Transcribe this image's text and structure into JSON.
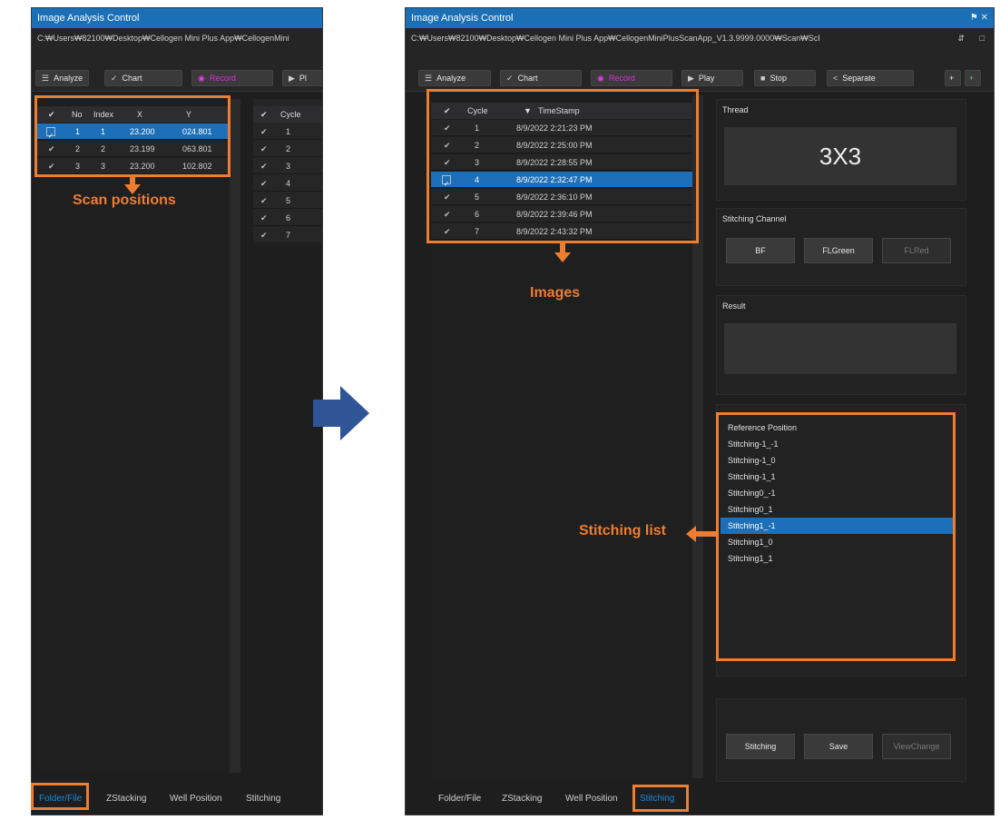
{
  "left_window": {
    "title": "Image Analysis Control",
    "path": "C:₩Users₩82100₩Desktop₩Cellogen Mini Plus App₩CellogenMini",
    "toolbar": {
      "analyze": "Analyze",
      "chart": "Chart",
      "record": "Record",
      "play": "Pl"
    },
    "scan_table": {
      "headers": [
        "✔",
        "No",
        "Index",
        "X",
        "Y"
      ],
      "rows": [
        {
          "no": "1",
          "index": "1",
          "x": "23.200",
          "y": "024.801"
        },
        {
          "no": "2",
          "index": "2",
          "x": "23.199",
          "y": "063.801"
        },
        {
          "no": "3",
          "index": "3",
          "x": "23.200",
          "y": "102.802"
        }
      ]
    },
    "cycle_table": {
      "headers": [
        "✔",
        "Cycle"
      ],
      "rows": [
        "1",
        "2",
        "3",
        "4",
        "5",
        "6",
        "7"
      ]
    },
    "tabs": [
      "Folder/File",
      "ZStacking",
      "Well Position",
      "Stitching"
    ]
  },
  "right_window": {
    "title": "Image Analysis Control",
    "path": "C:₩Users₩82100₩Desktop₩Cellogen Mini Plus App₩CellogenMiniPlusScanApp_V1.3.9999.0000₩Scan₩ScI",
    "toolbar": {
      "analyze": "Analyze",
      "chart": "Chart",
      "record": "Record",
      "play": "Play",
      "stop": "Stop",
      "separate": "Separate"
    },
    "images_table": {
      "headers": [
        "✔",
        "Cycle",
        "TimeStamp"
      ],
      "rows": [
        {
          "cycle": "1",
          "ts": "8/9/2022 2:21:23 PM"
        },
        {
          "cycle": "2",
          "ts": "8/9/2022 2:25:00 PM"
        },
        {
          "cycle": "3",
          "ts": "8/9/2022 2:28:55 PM"
        },
        {
          "cycle": "4",
          "ts": "8/9/2022 2:32:47 PM"
        },
        {
          "cycle": "5",
          "ts": "8/9/2022 2:36:10 PM"
        },
        {
          "cycle": "6",
          "ts": "8/9/2022 2:39:46 PM"
        },
        {
          "cycle": "7",
          "ts": "8/9/2022 2:43:32 PM"
        }
      ]
    },
    "thread_label": "Thread",
    "thread_value": "3X3",
    "channel_label": "Stitching Channel",
    "channels": [
      "BF",
      "FLGreen",
      "FLRed"
    ],
    "result_label": "Result",
    "stitching_list": [
      "Reference Position",
      "Stitching-1_-1",
      "Stitching-1_0",
      "Stitching-1_1",
      "Stitching0_-1",
      "Stitching0_1",
      "Stitching1_-1",
      "Stitching1_0",
      "Stitching1_1"
    ],
    "actions": [
      "Stitching",
      "Save",
      "ViewChange"
    ],
    "tabs": [
      "Folder/File",
      "ZStacking",
      "Well Position",
      "Stitching"
    ]
  },
  "annotations": {
    "scan_positions": "Scan positions",
    "images": "Images",
    "stitching_list": "Stitching list"
  },
  "colors": {
    "accent": "#ed7d31",
    "selection": "#1c6fb8",
    "titlebar": "#1b6fb5",
    "arrow": "#2f5597"
  }
}
